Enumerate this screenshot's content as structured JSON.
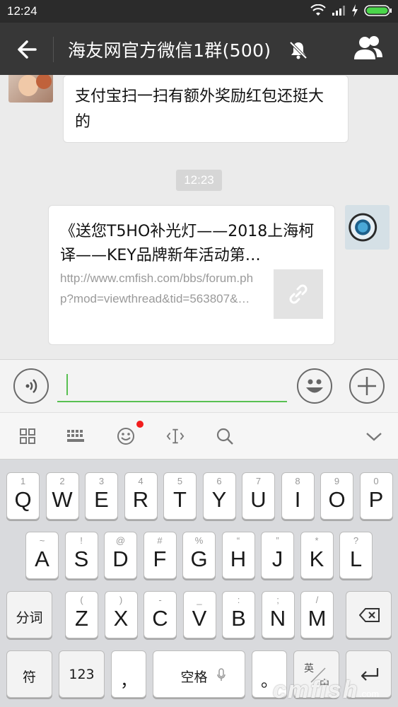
{
  "status_bar": {
    "time": "12:24"
  },
  "header": {
    "title": "海友网官方微信1群(500)"
  },
  "messages": {
    "incoming_text": "支付宝扫一扫有额外奖励红包还挺大的",
    "timestamp": "12:23",
    "link_card": {
      "title": "《送您T5HO补光灯——2018上海柯译——KEY品牌新年活动第…",
      "url": "http://www.cmfish.com/bbs/forum.php?mod=viewthread&tid=563807&…"
    }
  },
  "input": {
    "value": ""
  },
  "keyboard": {
    "row1": [
      {
        "sub": "1",
        "main": "Q"
      },
      {
        "sub": "2",
        "main": "W"
      },
      {
        "sub": "3",
        "main": "E"
      },
      {
        "sub": "4",
        "main": "R"
      },
      {
        "sub": "5",
        "main": "T"
      },
      {
        "sub": "6",
        "main": "Y"
      },
      {
        "sub": "7",
        "main": "U"
      },
      {
        "sub": "8",
        "main": "I"
      },
      {
        "sub": "9",
        "main": "O"
      },
      {
        "sub": "0",
        "main": "P"
      }
    ],
    "row2": [
      {
        "sub": "~",
        "main": "A"
      },
      {
        "sub": "!",
        "main": "S"
      },
      {
        "sub": "@",
        "main": "D"
      },
      {
        "sub": "#",
        "main": "F"
      },
      {
        "sub": "%",
        "main": "G"
      },
      {
        "sub": "“",
        "main": "H"
      },
      {
        "sub": "”",
        "main": "J"
      },
      {
        "sub": "*",
        "main": "K"
      },
      {
        "sub": "?",
        "main": "L"
      }
    ],
    "row3": [
      {
        "sub": "(",
        "main": "Z"
      },
      {
        "sub": ")",
        "main": "X"
      },
      {
        "sub": "-",
        "main": "C"
      },
      {
        "sub": "_",
        "main": "V"
      },
      {
        "sub": ":",
        "main": "B"
      },
      {
        "sub": ";",
        "main": "N"
      },
      {
        "sub": "/",
        "main": "M"
      }
    ],
    "segment_label": "分词",
    "symbol_label": "符",
    "num_label": "123",
    "comma_label": "，",
    "space_label": "空格",
    "period_label": "。",
    "lang_top": "英",
    "lang_bottom": "中"
  },
  "watermark": {
    "text": "cmfish",
    "suffix": ".com"
  }
}
